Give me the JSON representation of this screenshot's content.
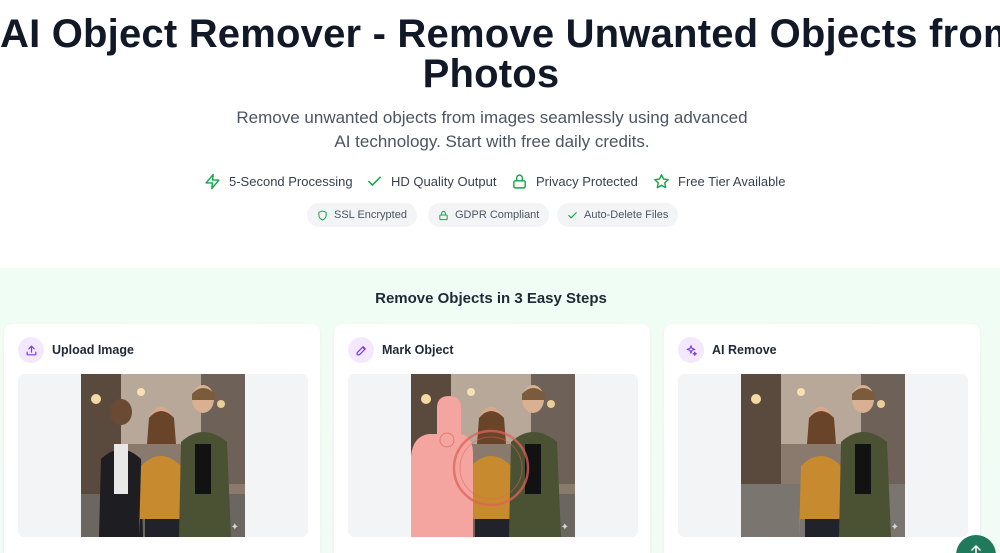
{
  "hero": {
    "title_line1": "AI Object Remover - Remove Unwanted Objects from",
    "title_line2": "Photos",
    "subtitle": "Remove unwanted objects from images seamlessly using advanced AI technology. Start with free daily credits."
  },
  "features": [
    {
      "label": "5-Second Processing",
      "icon": "lightning-icon"
    },
    {
      "label": "HD Quality Output",
      "icon": "check-icon"
    },
    {
      "label": "Privacy Protected",
      "icon": "lock-icon"
    },
    {
      "label": "Free Tier Available",
      "icon": "star-icon"
    }
  ],
  "badges": [
    {
      "label": "SSL Encrypted",
      "icon": "shield-icon"
    },
    {
      "label": "GDPR Compliant",
      "icon": "lock-icon"
    },
    {
      "label": "Auto-Delete Files",
      "icon": "check-icon"
    }
  ],
  "steps": {
    "title": "Remove Objects in 3 Easy Steps",
    "cards": [
      {
        "label": "Upload Image",
        "icon": "upload-icon"
      },
      {
        "label": "Mark Object",
        "icon": "edit-icon"
      },
      {
        "label": "AI Remove",
        "icon": "sparkles-icon"
      }
    ]
  },
  "colors": {
    "accent_green": "#16a34a",
    "fab_green": "#1f7a5c",
    "step_icon_bg": "#f3e8ff",
    "step_icon_fg": "#7c3aed",
    "mask_pink": "#f4a5a0"
  }
}
